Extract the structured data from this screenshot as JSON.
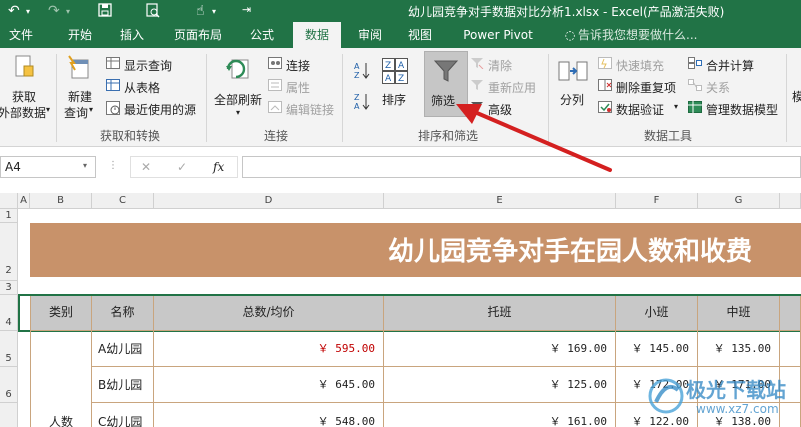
{
  "window": {
    "title": "幼儿园竞争对手数据对比分析1.xlsx - Excel(产品激活失败)"
  },
  "tabs": [
    {
      "label": "文件"
    },
    {
      "label": "开始"
    },
    {
      "label": "插入"
    },
    {
      "label": "页面布局"
    },
    {
      "label": "公式"
    },
    {
      "label": "数据"
    },
    {
      "label": "审阅"
    },
    {
      "label": "视图"
    },
    {
      "label": "Power Pivot"
    }
  ],
  "tell_me": "告诉我您想要做什么...",
  "ribbon": {
    "get_external": "获取",
    "get_external2": "外部数据",
    "new_query": "新建",
    "new_query2": "查询",
    "show_query": "显示查询",
    "from_table": "从表格",
    "recent_sources": "最近使用的源",
    "group_get_transform": "获取和转换",
    "refresh_all": "全部刷新",
    "connections": "连接",
    "properties": "属性",
    "edit_links": "编辑链接",
    "group_connections": "连接",
    "sort": "排序",
    "filter": "筛选",
    "clear": "清除",
    "reapply": "重新应用",
    "advanced": "高级",
    "group_sort_filter": "排序和筛选",
    "text_to_columns": "分列",
    "flash_fill": "快速填充",
    "remove_duplicates": "删除重复项",
    "data_validation": "数据验证",
    "consolidate": "合并计算",
    "relationships": "关系",
    "manage_data_model": "管理数据模型",
    "group_data_tools": "数据工具"
  },
  "formula_bar": {
    "name_box": "A4",
    "cancel": "✕",
    "enter": "✓",
    "fx": "fx",
    "formula": ""
  },
  "columns": [
    "A",
    "B",
    "C",
    "D",
    "E",
    "F",
    "G"
  ],
  "rows": [
    "1",
    "2",
    "3",
    "4",
    "5",
    "6"
  ],
  "sheet": {
    "title": "幼儿园竞争对手在园人数和收费",
    "headers": [
      "类别",
      "名称",
      "总数/均价",
      "托班",
      "小班",
      "中班"
    ],
    "category": "人数",
    "data": [
      {
        "name": "A幼儿园",
        "total": "￥ 595.00",
        "tuoban": "￥ 169.00",
        "xiaoban": "￥ 145.00",
        "zhongban": "￥ 135.00"
      },
      {
        "name": "B幼儿园",
        "total": "￥ 645.00",
        "tuoban": "￥ 125.00",
        "xiaoban": "￥ 172.00",
        "zhongban": "￥ 171.00"
      },
      {
        "name": "C幼儿园",
        "total": "￥ 548.00",
        "tuoban": "￥ 161.00",
        "xiaoban": "￥ 122.00",
        "zhongban": "￥ 138.00"
      }
    ]
  },
  "colors": {
    "excel_green": "#217346",
    "title_band": "#c8926a",
    "arrow": "#d42020",
    "red_value": "#c00000"
  },
  "watermark": {
    "brand": "极光下载站",
    "url": "www.xz7.com"
  }
}
